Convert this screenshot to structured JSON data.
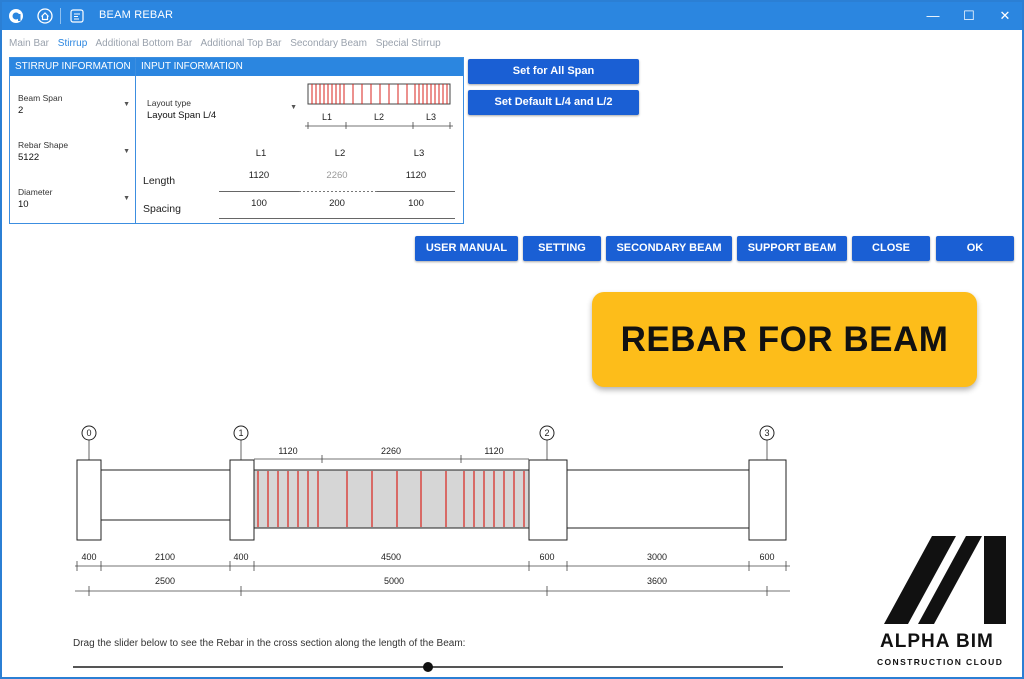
{
  "window": {
    "title": "BEAM REBAR",
    "minimize": "—",
    "maximize": "☐",
    "close": "✕",
    "colors": {
      "titlebar": "#2b86e0",
      "button": "#1a5fd4",
      "banner": "#fdbd1a",
      "rebar": "#d9231d"
    }
  },
  "tabs": [
    {
      "label": "Main Bar",
      "active": false
    },
    {
      "label": "Stirrup",
      "active": true
    },
    {
      "label": "Additional Bottom Bar",
      "active": false
    },
    {
      "label": "Additional Top Bar",
      "active": false
    },
    {
      "label": "Secondary Beam",
      "active": false
    },
    {
      "label": "Special Stirrup",
      "active": false
    }
  ],
  "stirrup_info": {
    "header": "STIRRUP INFORMATION",
    "beam_span": {
      "label": "Beam Span",
      "value": "2"
    },
    "rebar_shape": {
      "label": "Rebar Shape",
      "value": "5122"
    },
    "diameter": {
      "label": "Diameter",
      "value": "10"
    }
  },
  "input_info": {
    "header": "INPUT INFORMATION",
    "layout_type": {
      "label": "Layout type",
      "value": "Layout Span L/4"
    },
    "diagram_labels": [
      "L1",
      "L2",
      "L3"
    ],
    "columns": [
      "L1",
      "L2",
      "L3"
    ],
    "length_label": "Length",
    "length": [
      "1120",
      "2260",
      "1120"
    ],
    "spacing_label": "Spacing",
    "spacing": [
      "100",
      "200",
      "100"
    ]
  },
  "side_buttons": {
    "set_all": "Set for All Span",
    "set_default": "Set Default L/4 and L/2"
  },
  "action_buttons": {
    "user_manual": "USER MANUAL",
    "setting": "SETTING",
    "secondary_beam": "SECONDARY BEAM",
    "support_beam": "SUPPORT BEAM",
    "close": "CLOSE",
    "ok": "OK"
  },
  "banner": "REBAR FOR BEAM",
  "drawing": {
    "grid_labels": [
      "0",
      "1",
      "2",
      "3"
    ],
    "zone_dims": [
      "1120",
      "2260",
      "1120"
    ],
    "widths_row1": [
      "400",
      "2100",
      "400",
      "4500",
      "600",
      "3000",
      "600"
    ],
    "widths_row2": [
      "2500",
      "5000",
      "3600"
    ]
  },
  "hint": "Drag the slider below to see the Rebar in the cross section along the length of the Beam:",
  "slider": {
    "position": 0.5
  },
  "logo": {
    "name": "ALPHA BIM",
    "tagline": "CONSTRUCTION CLOUD"
  }
}
